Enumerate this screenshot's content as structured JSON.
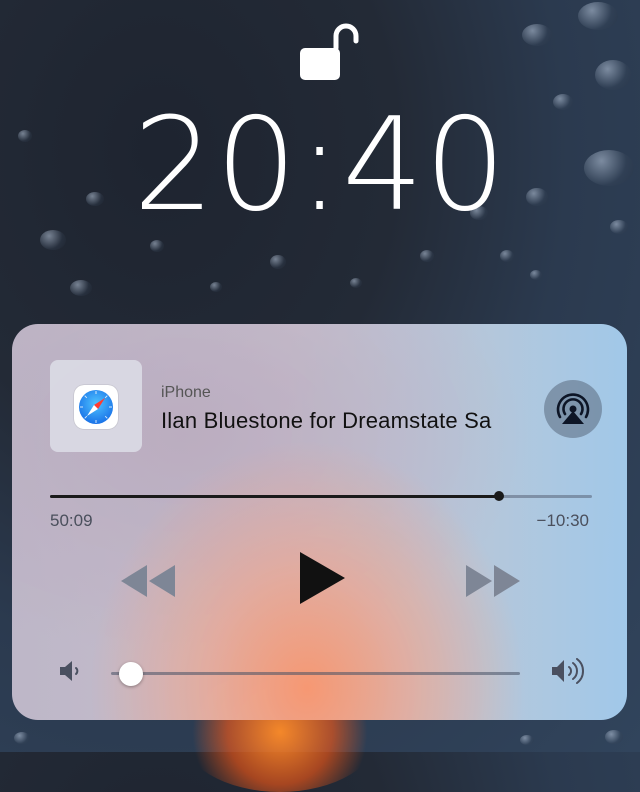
{
  "lock_screen": {
    "time": "20:40",
    "lock_icon": "unlocked-padlock-icon"
  },
  "now_playing": {
    "source_device": "iPhone",
    "track_title": "Ilan Bluestone for Dreamstate Sa",
    "app_icon": "safari-compass-icon",
    "airplay_icon": "airplay-icon",
    "elapsed": "50:09",
    "remaining": "−10:30",
    "progress_fraction": 0.828,
    "volume_fraction": 0.05,
    "controls": {
      "rewind_icon": "rewind-icon",
      "play_icon": "play-icon",
      "forward_icon": "fast-forward-icon",
      "volume_low_icon": "speaker-low-icon",
      "volume_high_icon": "speaker-high-icon"
    }
  },
  "colors": {
    "card_tint": "#c8c0d2",
    "glow": "#f4967a",
    "text_primary": "#111111",
    "text_secondary": "#4a4f5c",
    "knob": "#ffffff"
  }
}
